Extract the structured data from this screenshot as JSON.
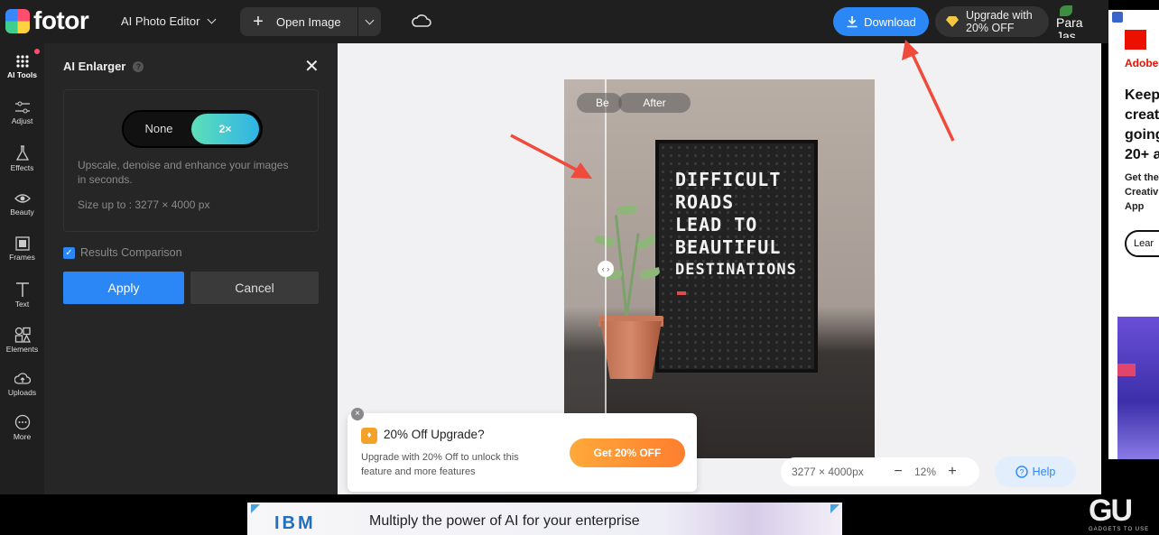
{
  "app": {
    "logo_text": "fotor",
    "editor_label": "AI Photo Editor",
    "open_image_label": "Open Image",
    "download_label": "Download",
    "upgrade_line1": "Upgrade with",
    "upgrade_line2": "20% OFF",
    "avatar_text": "Para\nJas"
  },
  "rail": {
    "items": [
      {
        "label": "AI Tools",
        "icon": "grid-dots-icon"
      },
      {
        "label": "Adjust",
        "icon": "sliders-icon"
      },
      {
        "label": "Effects",
        "icon": "flask-icon"
      },
      {
        "label": "Beauty",
        "icon": "eye-icon"
      },
      {
        "label": "Frames",
        "icon": "frame-icon"
      },
      {
        "label": "Text",
        "icon": "text-icon"
      },
      {
        "label": "Elements",
        "icon": "shapes-icon"
      },
      {
        "label": "Uploads",
        "icon": "upload-cloud-icon"
      },
      {
        "label": "More",
        "icon": "more-icon"
      }
    ]
  },
  "panel": {
    "title": "AI Enlarger",
    "toggle_none": "None",
    "toggle_2x": "2×",
    "desc": "Upscale, denoise and enhance your images in seconds.",
    "size": "Size up to : 3277 × 4000 px",
    "compare_label": "Results Comparison",
    "compare_checked": true,
    "apply_label": "Apply",
    "cancel_label": "Cancel"
  },
  "canvas": {
    "before_label": "Be",
    "after_label": "After",
    "board_lines": [
      "DIFFICULT",
      "ROADS",
      "LEAD TO",
      "BEAUTIFUL",
      "DESTINATIONS"
    ],
    "dimensions": "3277 × 4000px",
    "zoom": "12%",
    "help_label": "Help"
  },
  "promo": {
    "title": "20% Off Upgrade?",
    "desc": "Upgrade with 20% Off to unlock this feature and more features",
    "button": "Get 20% OFF"
  },
  "ads": {
    "side_brand": "Adobe",
    "side_head": "Keep creat going 20+ a",
    "side_sub": "Get the Creativ All App",
    "side_button": "Lear",
    "bottom_brand": "IBM",
    "bottom_text": "Multiply the power of AI for your enterprise"
  },
  "watermark": {
    "text": "GADGETS TO USE"
  },
  "colors": {
    "accent": "#2b87f5",
    "promo": "#ff8a2f",
    "arrow": "#f04a3a"
  }
}
